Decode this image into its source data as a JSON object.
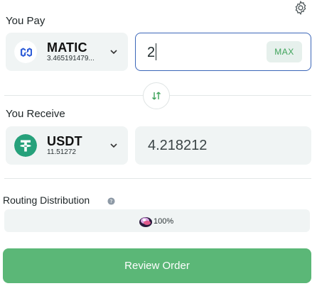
{
  "pay": {
    "label": "You Pay",
    "token": {
      "symbol": "MATIC",
      "balance": "3.465191479...",
      "icon": "matic-logo"
    },
    "amount": "2",
    "max_label": "MAX"
  },
  "receive": {
    "label": "You Receive",
    "token": {
      "symbol": "USDT",
      "balance": "11.51272",
      "icon": "usdt-logo"
    },
    "amount": "4.218212"
  },
  "routing": {
    "label": "Routing Distribution",
    "percent": "100%"
  },
  "review_label": "Review Order",
  "colors": {
    "accent_green": "#5bb777",
    "focus_blue": "#3b66b8",
    "usdt_green": "#26a17b",
    "matic_blue": "#2f5dd8",
    "panel_bg": "#f0f4f4"
  }
}
